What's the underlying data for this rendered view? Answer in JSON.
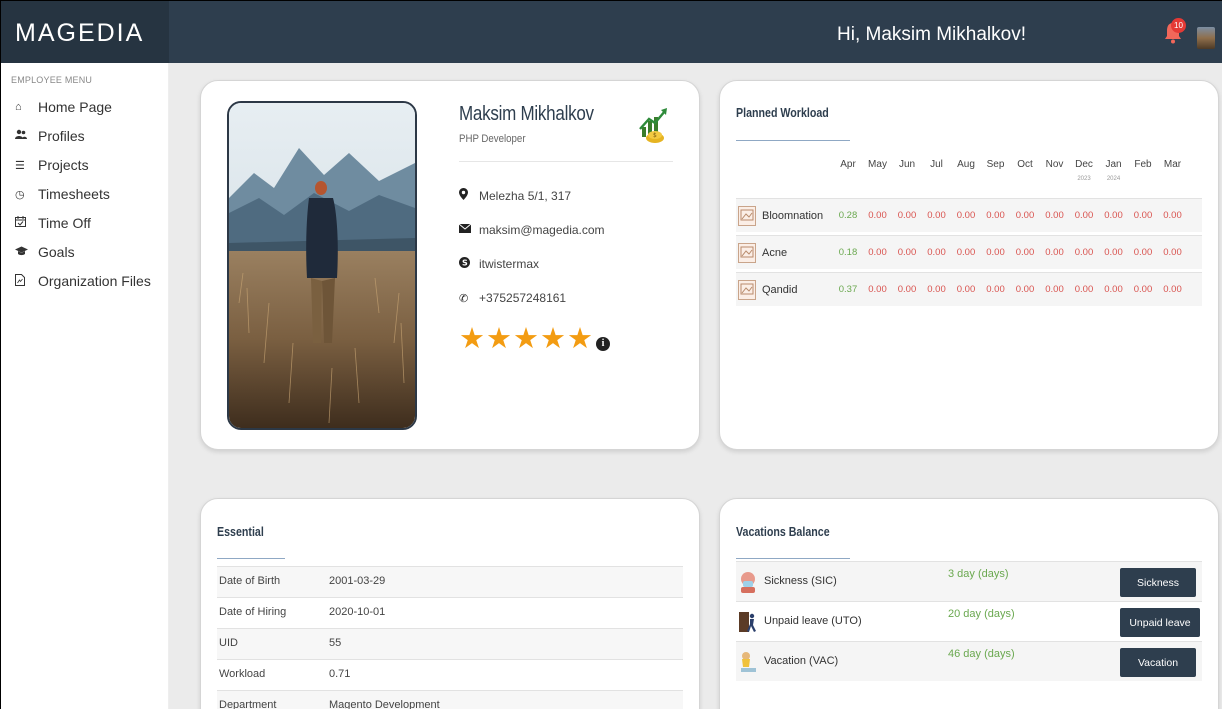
{
  "header": {
    "logo": "MAGEDIA",
    "greeting": "Hi, Maksim Mikhalkov!",
    "notification_count": "10",
    "colors": {
      "bar": "#2e3e4e",
      "logo_area": "#263441"
    }
  },
  "sidebar": {
    "title": "EMPLOYEE MENU",
    "items": [
      {
        "label": "Home Page",
        "icon": "home-icon"
      },
      {
        "label": "Profiles",
        "icon": "users-icon"
      },
      {
        "label": "Projects",
        "icon": "list-icon"
      },
      {
        "label": "Timesheets",
        "icon": "clock-icon"
      },
      {
        "label": "Time Off",
        "icon": "calendar-icon"
      },
      {
        "label": "Goals",
        "icon": "graduation-cap-icon"
      },
      {
        "label": "Organization Files",
        "icon": "file-icon"
      }
    ]
  },
  "profile": {
    "name": "Maksim Mikhalkov",
    "role": "PHP Developer",
    "address": "Melezha 5/1, 317",
    "email": "maksim@magedia.com",
    "skype": "itwistermax",
    "phone": "+375257248161",
    "rating": 5,
    "rating_max": 5
  },
  "workload": {
    "title": "Planned Workload",
    "months": [
      {
        "m": "Apr",
        "y": ""
      },
      {
        "m": "May",
        "y": ""
      },
      {
        "m": "Jun",
        "y": ""
      },
      {
        "m": "Jul",
        "y": ""
      },
      {
        "m": "Aug",
        "y": ""
      },
      {
        "m": "Sep",
        "y": ""
      },
      {
        "m": "Oct",
        "y": ""
      },
      {
        "m": "Nov",
        "y": ""
      },
      {
        "m": "Dec",
        "y": "2023"
      },
      {
        "m": "Jan",
        "y": "2024"
      },
      {
        "m": "Feb",
        "y": ""
      },
      {
        "m": "Mar",
        "y": ""
      }
    ],
    "rows": [
      {
        "project": "Bloomnation",
        "values": [
          "0.28",
          "0.00",
          "0.00",
          "0.00",
          "0.00",
          "0.00",
          "0.00",
          "0.00",
          "0.00",
          "0.00",
          "0.00",
          "0.00"
        ]
      },
      {
        "project": "Acne",
        "values": [
          "0.18",
          "0.00",
          "0.00",
          "0.00",
          "0.00",
          "0.00",
          "0.00",
          "0.00",
          "0.00",
          "0.00",
          "0.00",
          "0.00"
        ]
      },
      {
        "project": "Qandid",
        "values": [
          "0.37",
          "0.00",
          "0.00",
          "0.00",
          "0.00",
          "0.00",
          "0.00",
          "0.00",
          "0.00",
          "0.00",
          "0.00",
          "0.00"
        ]
      }
    ],
    "colors": {
      "positive": "#6aa84f",
      "zero": "#d9534f"
    }
  },
  "essential": {
    "title": "Essential",
    "rows": [
      {
        "label": "Date of Birth",
        "value": "2001-03-29"
      },
      {
        "label": "Date of Hiring",
        "value": "2020-10-01"
      },
      {
        "label": "UID",
        "value": "55"
      },
      {
        "label": "Workload",
        "value": "0.71"
      },
      {
        "label": "Department",
        "value": "Magento Development"
      }
    ]
  },
  "vacations": {
    "title": "Vacations Balance",
    "rows": [
      {
        "name": "Sickness (SIC)",
        "days": "3 day (days)",
        "button": "Sickness",
        "icon": "sick-person-icon"
      },
      {
        "name": "Unpaid leave (UTO)",
        "days": "20 day (days)",
        "button": "Unpaid leave",
        "icon": "door-exit-icon"
      },
      {
        "name": "Vacation (VAC)",
        "days": "46 day (days)",
        "button": "Vacation",
        "icon": "beach-person-icon"
      }
    ]
  },
  "accent": "#f39c12"
}
